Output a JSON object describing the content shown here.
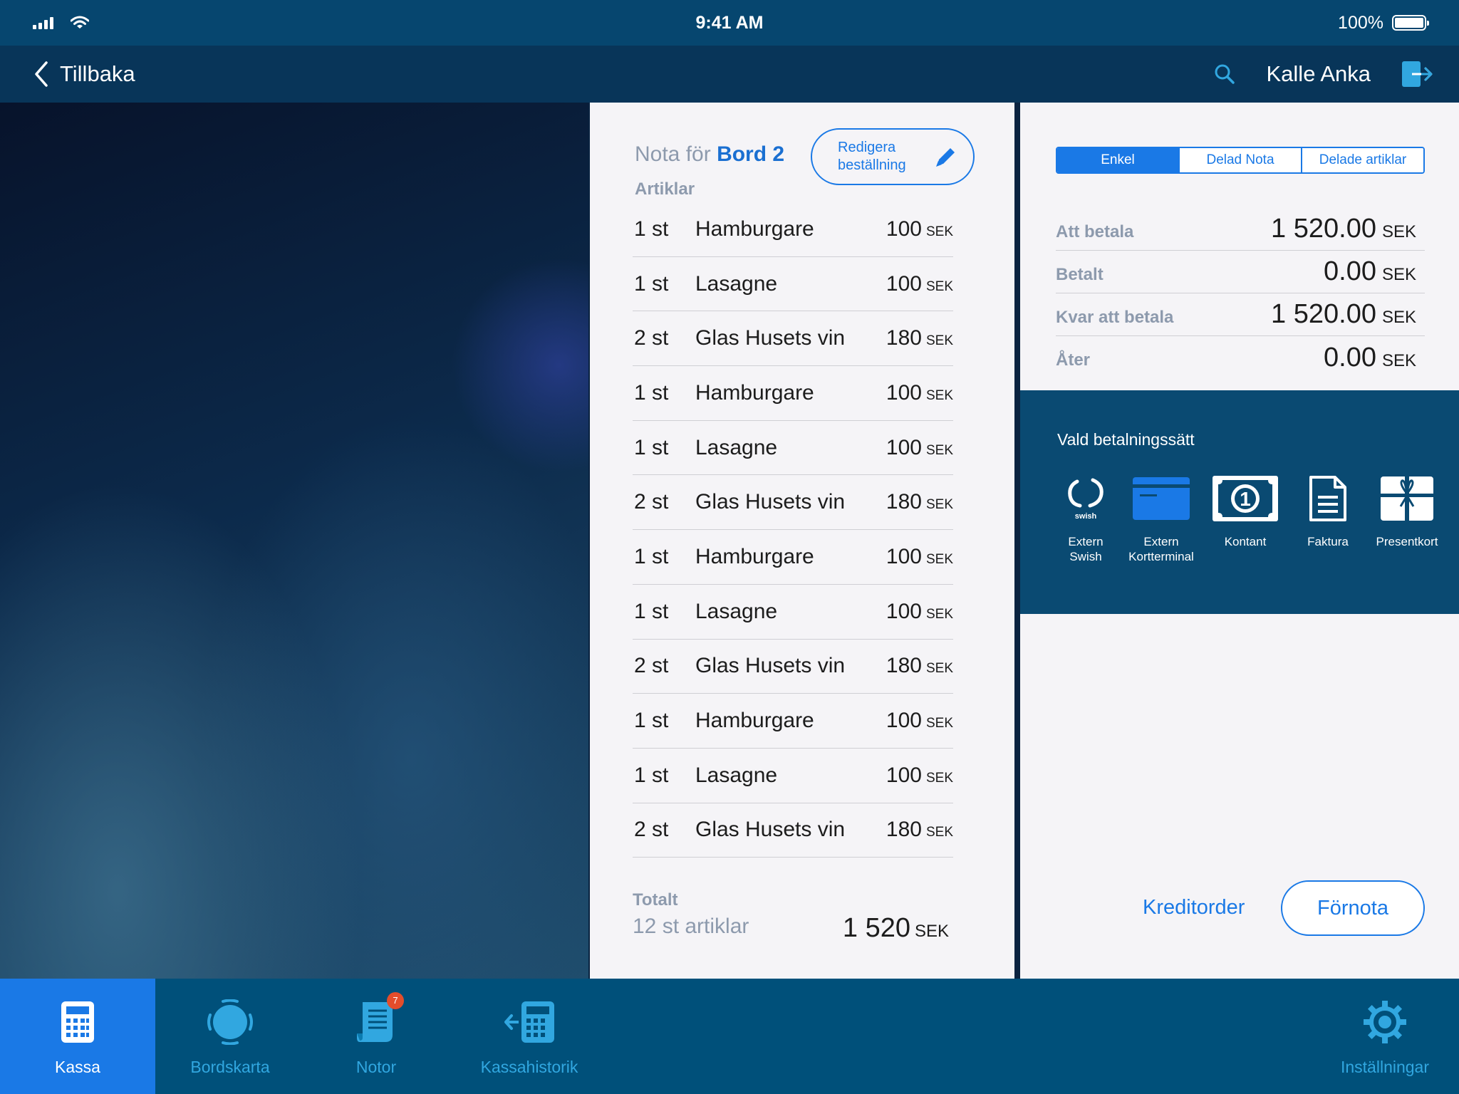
{
  "status_bar": {
    "time": "9:41 AM",
    "battery_percent": "100%",
    "battery_level": 1.0
  },
  "nav": {
    "back_label": "Tillbaka",
    "user_name": "Kalle Anka"
  },
  "bill": {
    "title_prefix": "Nota för",
    "table_name": "Bord 2",
    "edit_button_label": "Redigera beställning",
    "items_heading": "Artiklar",
    "currency": "SEK",
    "items": [
      {
        "qty": "1 st",
        "name": "Hamburgare",
        "price": "100"
      },
      {
        "qty": "1 st",
        "name": "Lasagne",
        "price": "100"
      },
      {
        "qty": "2 st",
        "name": "Glas Husets vin",
        "price": "180"
      },
      {
        "qty": "1 st",
        "name": "Hamburgare",
        "price": "100"
      },
      {
        "qty": "1 st",
        "name": "Lasagne",
        "price": "100"
      },
      {
        "qty": "2 st",
        "name": "Glas Husets vin",
        "price": "180"
      },
      {
        "qty": "1 st",
        "name": "Hamburgare",
        "price": "100"
      },
      {
        "qty": "1 st",
        "name": "Lasagne",
        "price": "100"
      },
      {
        "qty": "2 st",
        "name": "Glas Husets vin",
        "price": "180"
      },
      {
        "qty": "1 st",
        "name": "Hamburgare",
        "price": "100"
      },
      {
        "qty": "1 st",
        "name": "Lasagne",
        "price": "100"
      },
      {
        "qty": "2 st",
        "name": "Glas Husets vin",
        "price": "180"
      }
    ],
    "total_label": "Totalt",
    "total_count": "12 st artiklar",
    "total_amount": "1 520"
  },
  "payment": {
    "segments": [
      {
        "label": "Enkel",
        "active": true
      },
      {
        "label": "Delad Nota",
        "active": false
      },
      {
        "label": "Delade artiklar",
        "active": false
      }
    ],
    "currency": "SEK",
    "summary": [
      {
        "label": "Att betala",
        "value": "1 520.00"
      },
      {
        "label": "Betalt",
        "value": "0.00"
      },
      {
        "label": "Kvar att betala",
        "value": "1 520.00"
      },
      {
        "label": "Åter",
        "value": "0.00"
      }
    ],
    "methods_title": "Vald betalningssätt",
    "methods": [
      {
        "label": "Extern Swish",
        "icon": "swish-icon",
        "logo_text": "swish"
      },
      {
        "label": "Extern Kortterminal",
        "icon": "card-terminal-icon"
      },
      {
        "label": "Kontant",
        "icon": "cash-icon"
      },
      {
        "label": "Faktura",
        "icon": "invoice-icon"
      },
      {
        "label": "Presentkort",
        "icon": "gift-card-icon"
      }
    ],
    "credit_order_label": "Kreditorder",
    "prebill_label": "Förnota"
  },
  "tabs": [
    {
      "label": "Kassa",
      "icon": "calculator-icon",
      "active": true
    },
    {
      "label": "Bordskarta",
      "icon": "table-map-icon",
      "active": false
    },
    {
      "label": "Notor",
      "icon": "receipts-icon",
      "active": false,
      "badge": "7"
    },
    {
      "label": "Kassahistorik",
      "icon": "register-history-icon",
      "active": false
    },
    {
      "label": "Inställningar",
      "icon": "gear-icon",
      "active": false
    }
  ],
  "colors": {
    "accent": "#1a79e6",
    "nav_dark": "#083559",
    "tab_bar": "#00507a",
    "panel": "#f5f4f7",
    "badge": "#e34d2b"
  }
}
